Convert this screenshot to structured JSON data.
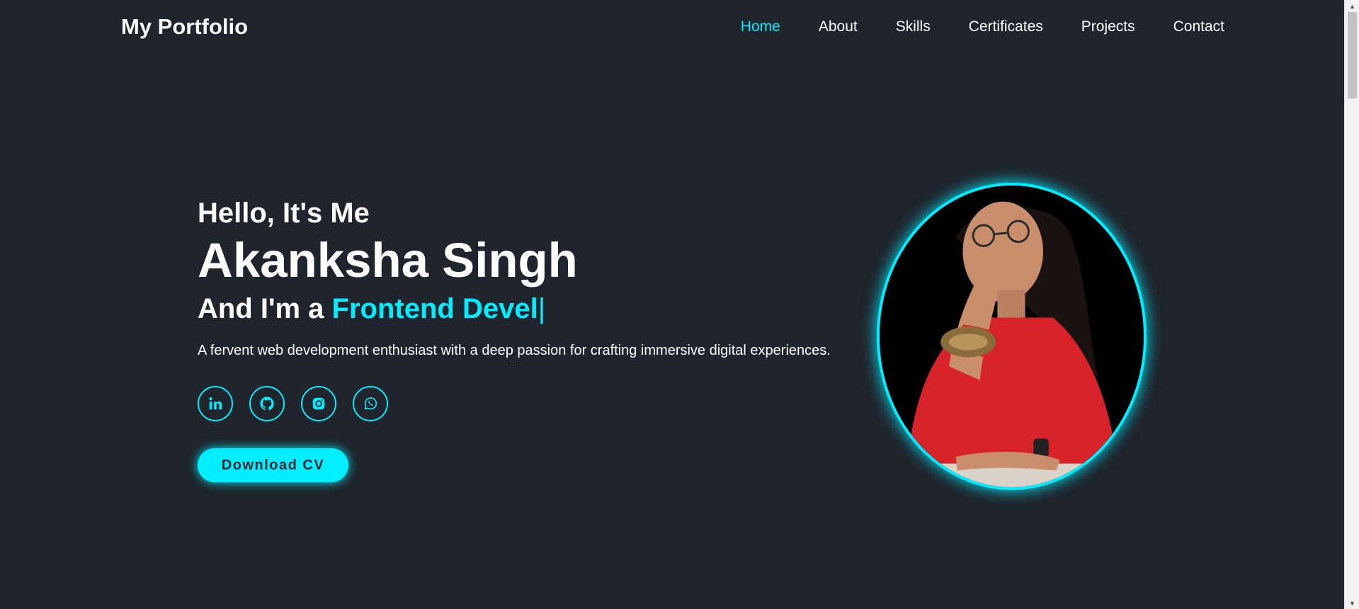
{
  "header": {
    "logo": "My Portfolio",
    "nav": [
      {
        "label": "Home",
        "active": true
      },
      {
        "label": "About"
      },
      {
        "label": "Skills"
      },
      {
        "label": "Certificates"
      },
      {
        "label": "Projects"
      },
      {
        "label": "Contact"
      }
    ]
  },
  "hero": {
    "greeting": "Hello, It's Me",
    "name": "Akanksha Singh",
    "role_prefix": "And I'm a",
    "role_typed": "Frontend Devel",
    "cursor": "|",
    "tagline": "A fervent web development enthusiast with a deep passion for crafting immersive digital experiences.",
    "cv_button": "Download CV"
  },
  "socials": [
    {
      "icon": "linkedin-icon"
    },
    {
      "icon": "github-icon"
    },
    {
      "icon": "instagram-icon"
    },
    {
      "icon": "whatsapp-icon"
    }
  ],
  "colors": {
    "background": "#1f242d",
    "accent": "#00eeff",
    "text": "#ffffff"
  }
}
